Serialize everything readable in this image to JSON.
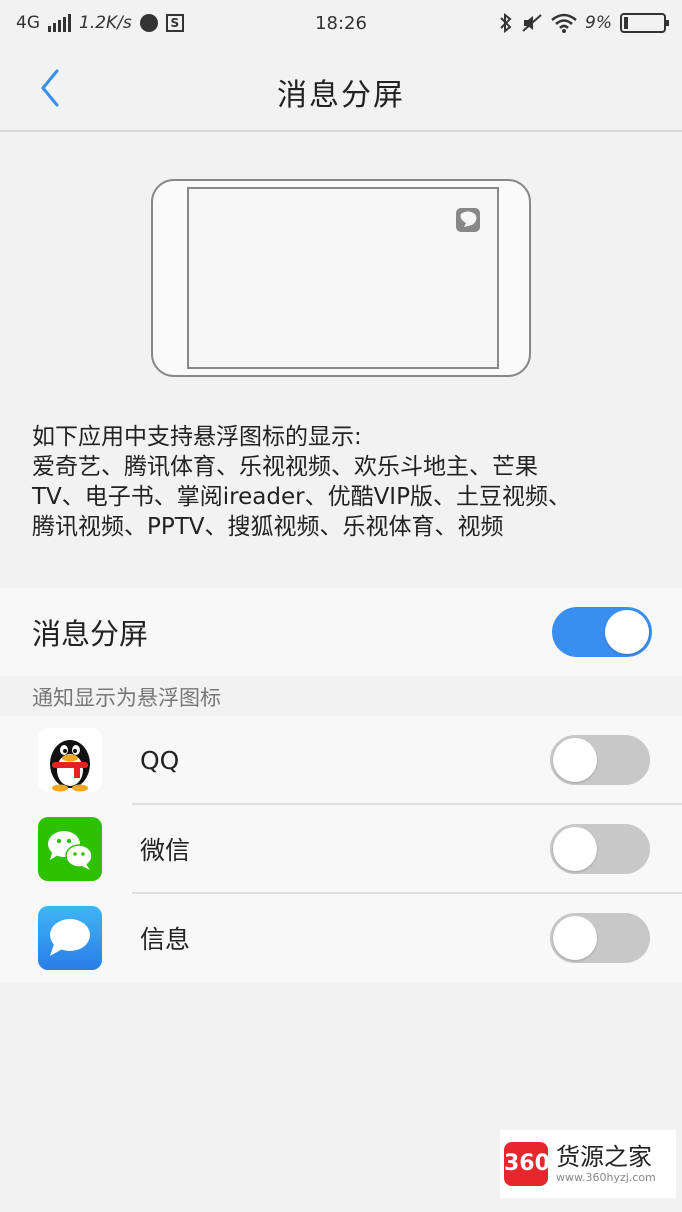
{
  "status_bar": {
    "network": "4G",
    "speed": "1.2K/s",
    "time": "18:26",
    "battery": "9%"
  },
  "header": {
    "title": "消息分屏",
    "back_icon": "chevron-left-icon"
  },
  "description": {
    "line1": "如下应用中支持悬浮图标的显示:",
    "line2": "爱奇艺、腾讯体育、乐视视频、欢乐斗地主、芒果",
    "line3": "TV、电子书、掌阅ireader、优酷VIP版、土豆视频、",
    "line4": "腾讯视频、PPTV、搜狐视频、乐视体育、视频"
  },
  "main_setting": {
    "label": "消息分屏",
    "enabled": true
  },
  "section_header": "通知显示为悬浮图标",
  "apps": [
    {
      "name": "QQ",
      "icon": "qq-penguin-icon",
      "enabled": false
    },
    {
      "name": "微信",
      "icon": "wechat-icon",
      "enabled": false
    },
    {
      "name": "信息",
      "icon": "messages-icon",
      "enabled": false
    }
  ],
  "watermark": {
    "logo": "360",
    "name": "货源之家",
    "url": "www.360hyzj.com"
  },
  "colors": {
    "accent": "#3a8ef0",
    "toggle_off": "#c8c8c8",
    "background": "#f2f2f2"
  }
}
